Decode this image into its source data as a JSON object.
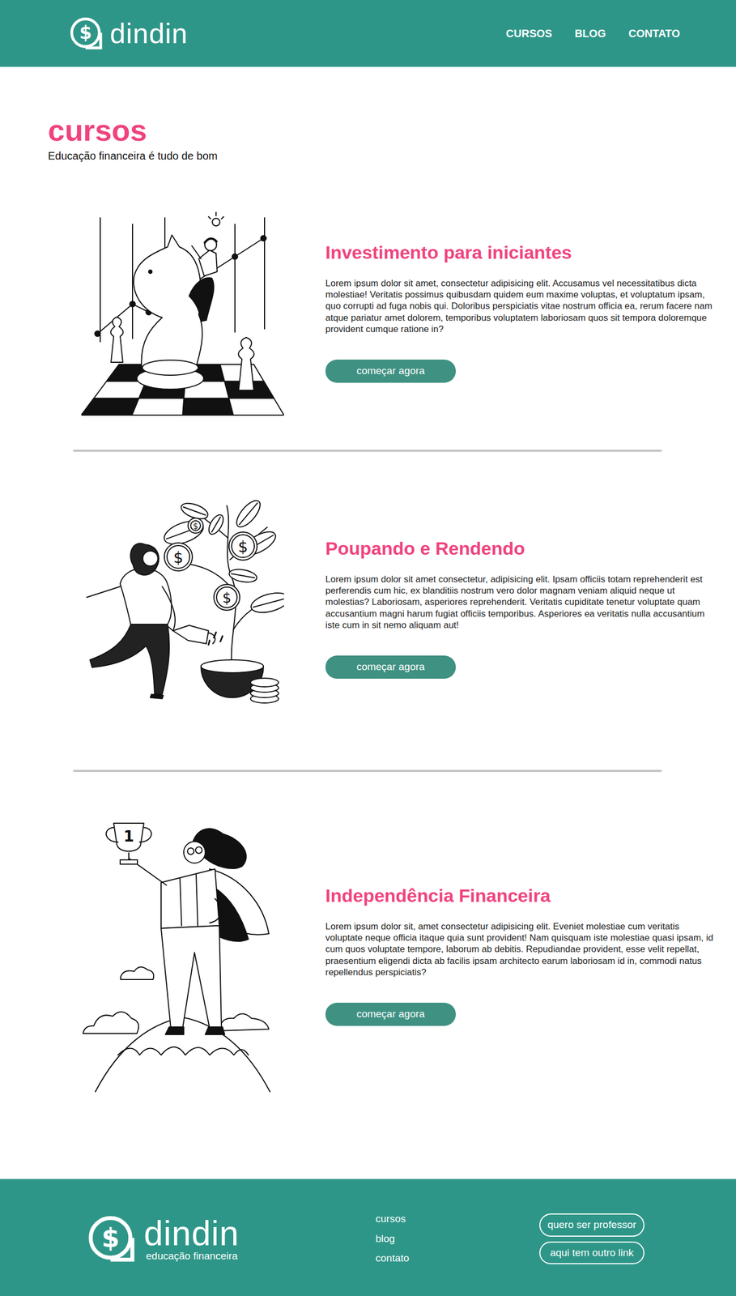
{
  "header": {
    "logo": {
      "symbol": "$",
      "name": "dindin"
    },
    "nav": [
      {
        "label": "CURSOS"
      },
      {
        "label": "BLOG"
      },
      {
        "label": "CONTATO"
      }
    ]
  },
  "page": {
    "title": "cursos",
    "subtitle": "Educação financeira é tudo de bom"
  },
  "illustration_marks": {
    "coin": "$",
    "trophy": "1"
  },
  "courses": [
    {
      "kind": "chess",
      "title": "Investimento para iniciantes",
      "text": "Lorem ipsum dolor sit amet, consectetur adipisicing elit. Accusamus vel necessitatibus dicta molestiae! Veritatis possimus quibusdam quidem eum maxime voluptas, et voluptatum ipsam, quo corrupti ad fuga nobis qui. Doloribus perspiciatis vitae nostrum officia ea, rerum facere nam atque pariatur amet dolorem, temporibus voluptatem laboriosam quos sit tempora doloremque provident cumque ratione in?",
      "button": "começar agora"
    },
    {
      "kind": "plant",
      "title": "Poupando e Rendendo",
      "text": "Lorem ipsum dolor sit amet consectetur, adipisicing elit. Ipsam officiis totam reprehenderit est perferendis cum hic, ex blanditiis nostrum vero dolor magnam veniam aliquid neque ut molestias? Laboriosam, asperiores reprehenderit. Veritatis cupiditate tenetur voluptate quam accusantium magni harum fugiat officiis temporibus. Asperiores ea veritatis nulla accusantium iste cum in sit nemo aliquam aut!",
      "button": "começar agora"
    },
    {
      "kind": "hero",
      "title": "Independência Financeira",
      "text": "Lorem ipsum dolor sit, amet consectetur adipisicing elit. Eveniet molestiae cum veritatis voluptate neque officia itaque quia sunt provident! Nam quisquam iste molestiae quasi ipsam, id cum quos voluptate tempore, laborum ab debitis. Repudiandae provident, esse velit repellat, praesentium eligendi dicta ab facilis ipsam architecto earum laboriosam id in, commodi natus repellendus perspiciatis?",
      "button": "começar agora"
    }
  ],
  "footer": {
    "logo": {
      "symbol": "$",
      "name": "dindin",
      "tagline": "educação financeira"
    },
    "links": [
      "cursos",
      "blog",
      "contato"
    ],
    "buttons": [
      "quero ser professor",
      "aqui tem outro link"
    ]
  }
}
